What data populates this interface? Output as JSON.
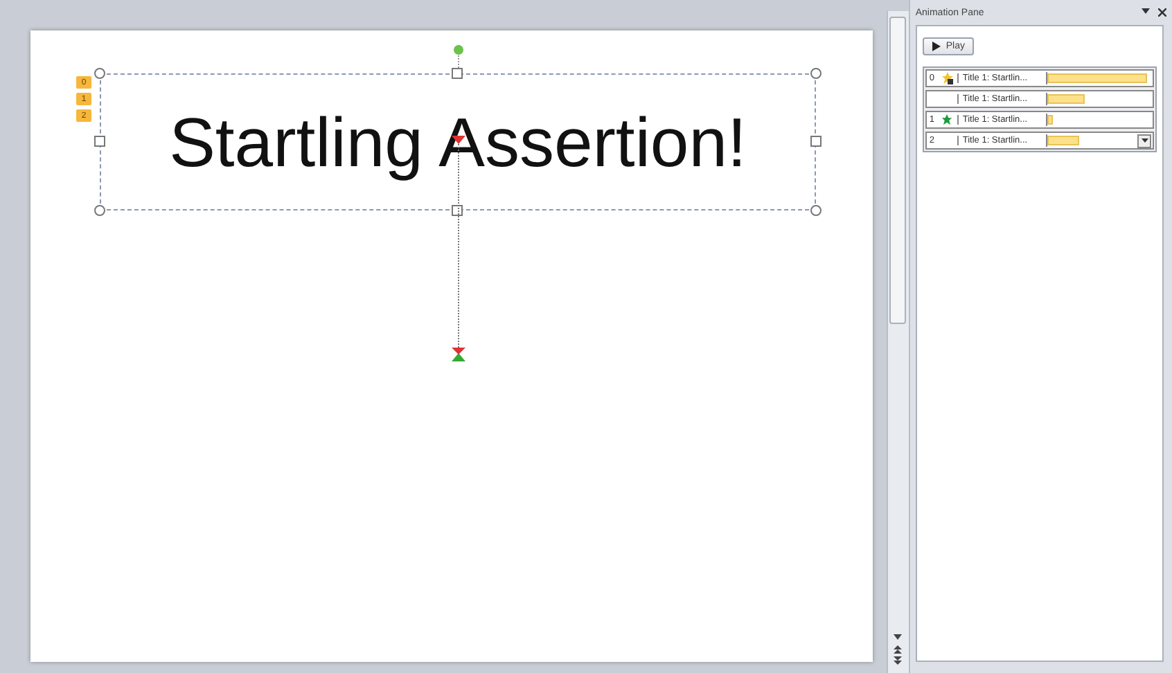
{
  "slide": {
    "title": "Startling Assertion!",
    "animation_badges": [
      "0",
      "1",
      "2"
    ]
  },
  "animation_pane": {
    "title": "Animation Pane",
    "play_button": "Play",
    "items": [
      {
        "number": "0",
        "kind": "emphasis",
        "label": "Title 1: Startlin...",
        "level": 0.95,
        "selected": false,
        "dropdown": false
      },
      {
        "kind": "none",
        "label": "Title 1: Startlin...",
        "level": 0.35,
        "selected": false,
        "dropdown": false
      },
      {
        "number": "1",
        "kind": "entrance",
        "label": "Title 1: Startlin...",
        "level": 0.05,
        "selected": false,
        "dropdown": false
      },
      {
        "number": "2",
        "kind": "none",
        "label": "Title 1: Startlin...",
        "level": 0.35,
        "selected": false,
        "dropdown": true
      }
    ]
  }
}
